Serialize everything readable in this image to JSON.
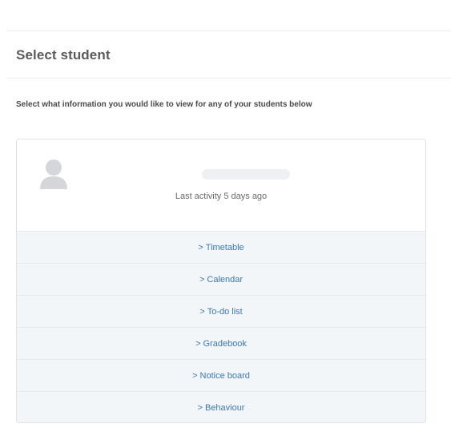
{
  "header": {
    "title": "Select student"
  },
  "instructions": "Select what information you would like to view for any of your students below",
  "student_card": {
    "avatar_icon": "user-silhouette-icon",
    "last_activity": "Last activity 5 days ago",
    "menu": [
      {
        "prefix": ">",
        "label": "Timetable"
      },
      {
        "prefix": ">",
        "label": "Calendar"
      },
      {
        "prefix": ">",
        "label": "To-do list"
      },
      {
        "prefix": ">",
        "label": "Gradebook"
      },
      {
        "prefix": ">",
        "label": "Notice board"
      },
      {
        "prefix": ">",
        "label": "Behaviour"
      }
    ]
  },
  "colors": {
    "link": "#3a78b8",
    "menu_background": "#f3f6f9",
    "divider": "#e6e9ed"
  }
}
